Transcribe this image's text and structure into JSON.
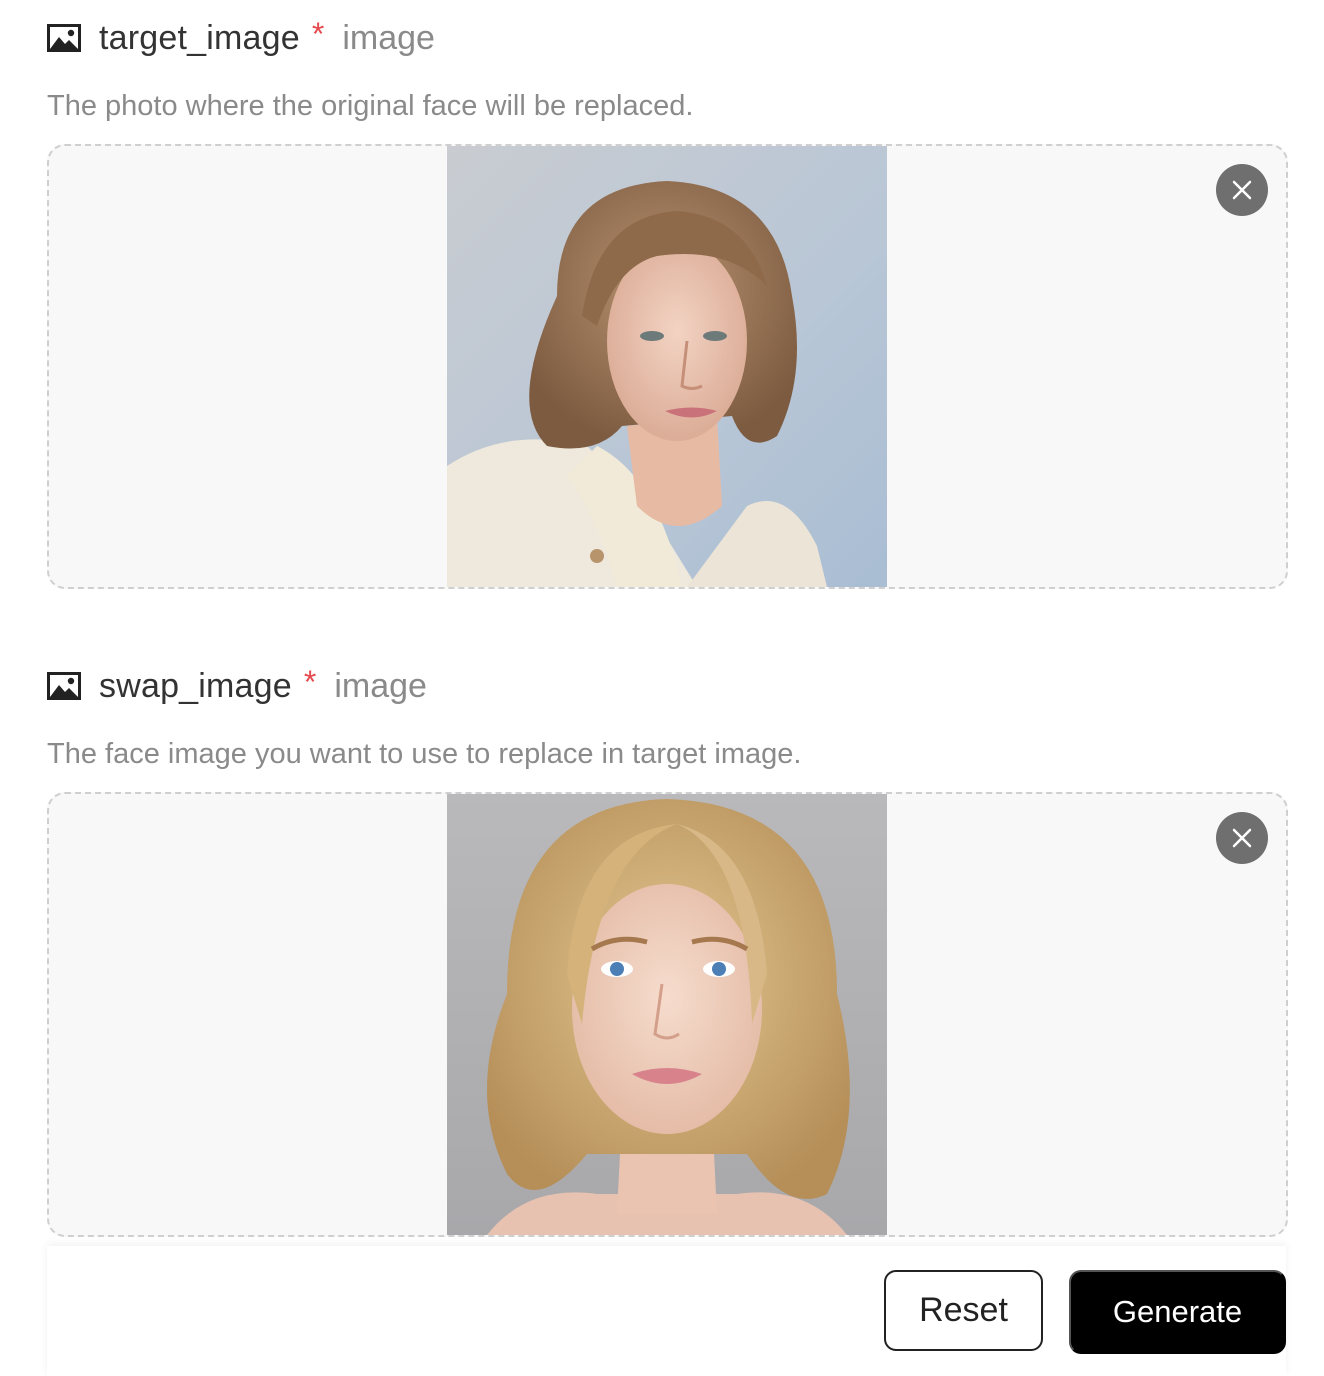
{
  "fields": [
    {
      "icon": "image-icon",
      "name": "target_image",
      "required_mark": "*",
      "type": "image",
      "description": "The photo where the original face will be replaced.",
      "preview": "portrait of young man with wavy shoulder-length light brown hair, cream cardigan",
      "remove_icon": "close-icon"
    },
    {
      "icon": "image-icon",
      "name": "swap_image",
      "required_mark": "*",
      "type": "image",
      "description": "The face image you want to use to replace in target image.",
      "preview": "portrait of young woman with wavy blonde hair and blue eyes",
      "remove_icon": "close-icon"
    }
  ],
  "actions": {
    "reset_label": "Reset",
    "generate_label": "Generate"
  },
  "colors": {
    "required": "#e5484d",
    "primary_button": "#000000",
    "remove_button": "#6f6f6f"
  }
}
